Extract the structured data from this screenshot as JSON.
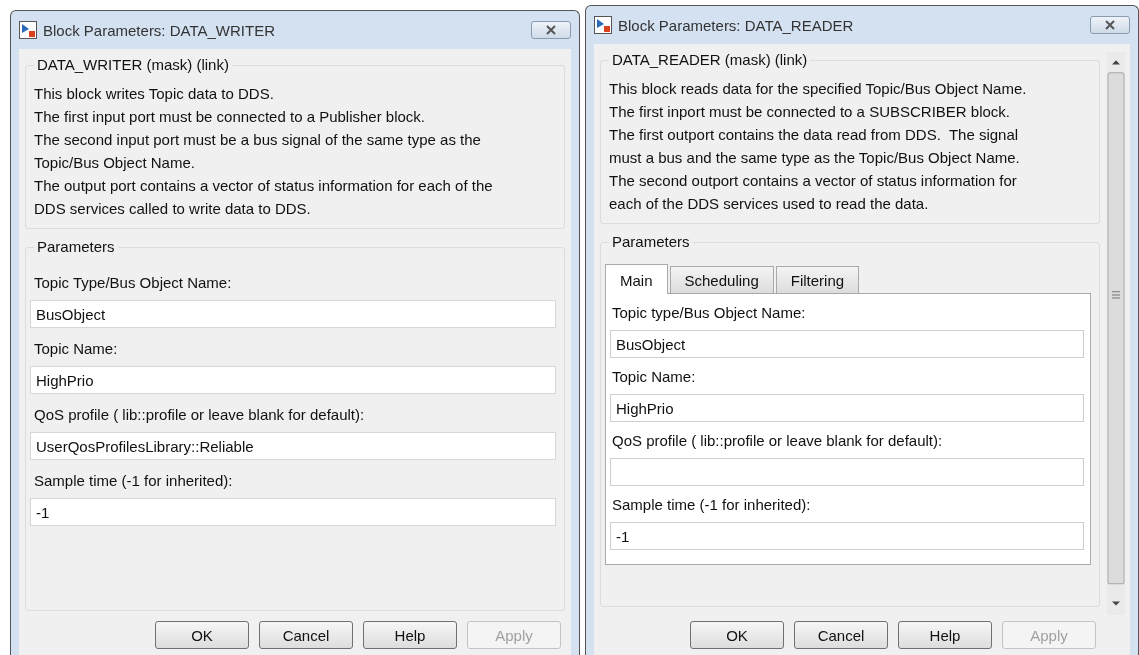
{
  "dialogs": [
    {
      "title": "Block Parameters: DATA_WRITER",
      "mask_title": "DATA_WRITER (mask) (link)",
      "description": [
        "This block writes Topic data to DDS.",
        "The first input port must be connected to a Publisher block.",
        "The second input port must be a bus signal of the same type as the",
        "Topic/Bus Object Name.",
        "The output port contains a vector of status information for each of the",
        "DDS services called to write data to DDS."
      ],
      "parameters_title": "Parameters",
      "scrollbar": false,
      "fields": [
        {
          "label": "Topic Type/Bus Object Name:",
          "value": "BusObject"
        },
        {
          "label": "Topic Name:",
          "value": "HighPrio"
        },
        {
          "label": "QoS profile ( lib::profile or leave blank for default):",
          "value": "UserQosProfilesLibrary::Reliable"
        },
        {
          "label": "Sample time (-1 for inherited):",
          "value": "-1"
        }
      ],
      "buttons": [
        {
          "label": "OK",
          "disabled": false
        },
        {
          "label": "Cancel",
          "disabled": false
        },
        {
          "label": "Help",
          "disabled": false
        },
        {
          "label": "Apply",
          "disabled": true
        }
      ]
    },
    {
      "title": "Block Parameters: DATA_READER",
      "mask_title": "DATA_READER (mask) (link)",
      "description": [
        "This block reads data for the specified Topic/Bus Object Name.",
        "The first inport must be connected to a SUBSCRIBER block.",
        "The first outport contains the data read from DDS.  The signal",
        "must a bus and the same type as the Topic/Bus Object Name.",
        "The second outport contains a vector of status information for",
        "each of the DDS services used to read the data."
      ],
      "parameters_title": "Parameters",
      "tabs": [
        {
          "label": "Main",
          "selected": true
        },
        {
          "label": "Scheduling",
          "selected": false
        },
        {
          "label": "Filtering",
          "selected": false
        }
      ],
      "scrollbar": true,
      "fields": [
        {
          "label": "Topic type/Bus Object Name:",
          "value": "BusObject"
        },
        {
          "label": "Topic Name:",
          "value": "HighPrio"
        },
        {
          "label": "QoS profile ( lib::profile or leave blank for default):"
        },
        {
          "label": "Sample time (-1 for inherited):",
          "value": "-1"
        }
      ],
      "buttons": [
        {
          "label": "OK",
          "disabled": false
        },
        {
          "label": "Cancel",
          "disabled": false
        },
        {
          "label": "Help",
          "disabled": false
        },
        {
          "label": "Apply",
          "disabled": true
        }
      ]
    }
  ]
}
